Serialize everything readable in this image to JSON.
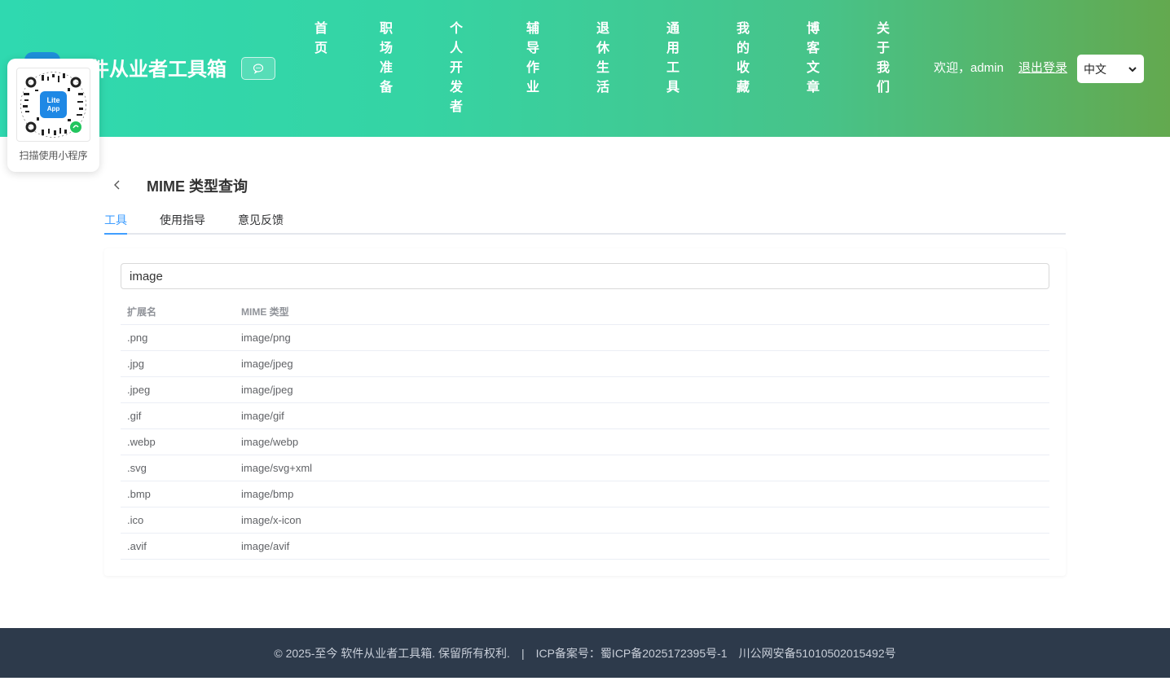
{
  "header": {
    "site_title": "件从业者工具箱",
    "nav": [
      {
        "label": "首页"
      },
      {
        "label": "职场准备"
      },
      {
        "label": "个人开发者"
      },
      {
        "label": "辅导作业"
      },
      {
        "label": "退休生活"
      },
      {
        "label": "通用工具"
      },
      {
        "label": "我的收藏"
      },
      {
        "label": "博客文章"
      },
      {
        "label": "关于我们"
      }
    ],
    "welcome": "欢迎，admin",
    "logout": "退出登录",
    "language": "中文"
  },
  "qr_card": {
    "caption": "扫描使用小程序",
    "badge": "Lite App"
  },
  "main": {
    "title": "MIME 类型查询",
    "tabs": [
      {
        "label": "工具",
        "active": true
      },
      {
        "label": "使用指导",
        "active": false
      },
      {
        "label": "意见反馈",
        "active": false
      }
    ],
    "search_value": "image",
    "table": {
      "headers": [
        "扩展名",
        "MIME 类型"
      ],
      "rows": [
        [
          ".png",
          "image/png"
        ],
        [
          ".jpg",
          "image/jpeg"
        ],
        [
          ".jpeg",
          "image/jpeg"
        ],
        [
          ".gif",
          "image/gif"
        ],
        [
          ".webp",
          "image/webp"
        ],
        [
          ".svg",
          "image/svg+xml"
        ],
        [
          ".bmp",
          "image/bmp"
        ],
        [
          ".ico",
          "image/x-icon"
        ],
        [
          ".avif",
          "image/avif"
        ]
      ]
    }
  },
  "footer": {
    "copyright": "© 2025-至今 软件从业者工具箱. 保留所有权利.",
    "separator": "|",
    "icp": "ICP备案号：蜀ICP备2025172395号-1",
    "police": "川公网安备51010502015492号"
  },
  "colors": {
    "accent": "#409eff",
    "header_start": "#2fd9b0",
    "header_end": "#63a94f",
    "footer_bg": "#2d3a4b"
  }
}
